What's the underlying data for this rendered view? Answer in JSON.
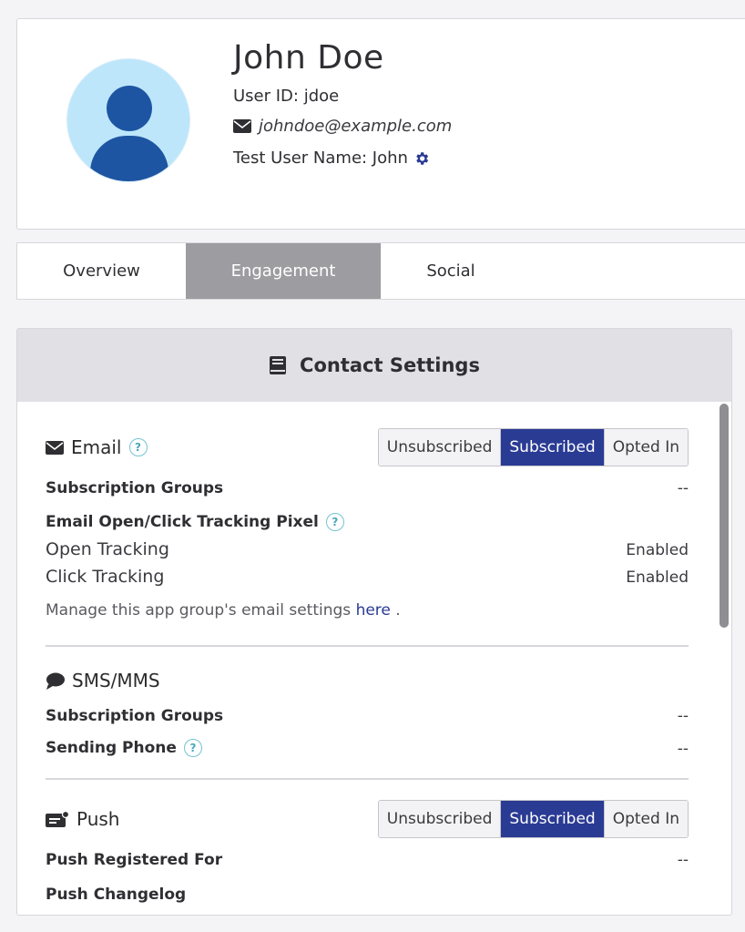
{
  "profile": {
    "name": "John Doe",
    "user_id": "User ID: jdoe",
    "email": "johndoe@example.com",
    "test_user": "Test User Name: John"
  },
  "tabs": [
    {
      "label": "Overview",
      "active": false
    },
    {
      "label": "Engagement",
      "active": true
    },
    {
      "label": "Social",
      "active": false
    }
  ],
  "panel": {
    "title": "Contact Settings"
  },
  "email": {
    "title": "Email",
    "toggle": [
      "Unsubscribed",
      "Subscribed",
      "Opted In"
    ],
    "selected": "Subscribed",
    "subscription_groups_label": "Subscription Groups",
    "subscription_groups_value": "--",
    "tracking_label": "Email Open/Click Tracking Pixel",
    "open_tracking_label": "Open Tracking",
    "open_tracking_value": "Enabled",
    "click_tracking_label": "Click Tracking",
    "click_tracking_value": "Enabled",
    "manage_note": "Manage this app group's email settings",
    "manage_link": "here",
    "manage_suffix": " ."
  },
  "sms": {
    "title": "SMS/MMS",
    "subscription_groups_label": "Subscription Groups",
    "subscription_groups_value": "--",
    "sending_phone_label": "Sending Phone",
    "sending_phone_value": "--"
  },
  "push": {
    "title": "Push",
    "toggle": [
      "Unsubscribed",
      "Subscribed",
      "Opted In"
    ],
    "selected": "Subscribed",
    "registered_label": "Push Registered For",
    "registered_value": "--",
    "changelog_label": "Push Changelog"
  },
  "colors": {
    "accent": "#2a3b94",
    "avatar_bg": "#bde6fb",
    "avatar_fg": "#1e55a2",
    "active_tab": "#9c9ca1"
  }
}
